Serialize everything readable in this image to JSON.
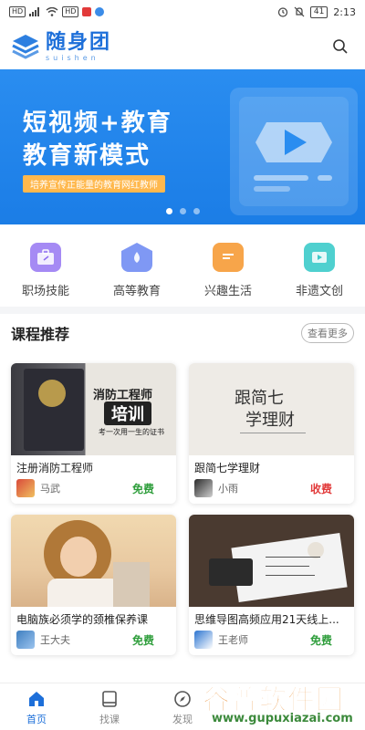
{
  "status_bar": {
    "left_chip1": "HD",
    "left_chip2": "HD",
    "battery": "41",
    "time": "2:13"
  },
  "header": {
    "logo_cn": "随身团",
    "logo_en": "suishen"
  },
  "banner": {
    "title_line1": "短视频+教育",
    "title_line2": "教育新模式",
    "subtitle": "培养宣传正能量的教育网红教师",
    "active_dot": 0
  },
  "categories": [
    {
      "label": "职场技能",
      "color": "#8d6cf0"
    },
    {
      "label": "高等教育",
      "color": "#6a86f2"
    },
    {
      "label": "兴趣生活",
      "color": "#f59b3a"
    },
    {
      "label": "非遗文创",
      "color": "#3fc8c8"
    }
  ],
  "section": {
    "title": "课程推荐",
    "more": "查看更多"
  },
  "courses": [
    {
      "title": "注册消防工程师",
      "teacher": "马武",
      "price": "免费",
      "price_color": "#2f9e3c",
      "img_text1": "消防工程师",
      "img_text2": "培训",
      "img_text3": "考一次用一生的证书"
    },
    {
      "title": "跟简七学理财",
      "teacher": "小雨",
      "price": "收费",
      "price_color": "#e23a3a",
      "img_text1": "跟简七",
      "img_text2": "学理财"
    },
    {
      "title": "电脑族必须学的颈椎保养课",
      "teacher": "王大夫",
      "price": "免费",
      "price_color": "#2f9e3c"
    },
    {
      "title": "思维导图高频应用21天线上...",
      "teacher": "王老师",
      "price": "免费",
      "price_color": "#2f9e3c"
    }
  ],
  "tabs": [
    {
      "label": "首页",
      "icon": "home-icon",
      "active": true
    },
    {
      "label": "找课",
      "icon": "book-icon",
      "active": false
    },
    {
      "label": "发现",
      "icon": "compass-icon",
      "active": false
    }
  ],
  "watermark": {
    "main": "谷普软件园",
    "url": "www.gupuxiazai.com"
  },
  "colors": {
    "brand": "#1d6fd9",
    "banner": "#1b7de6"
  }
}
